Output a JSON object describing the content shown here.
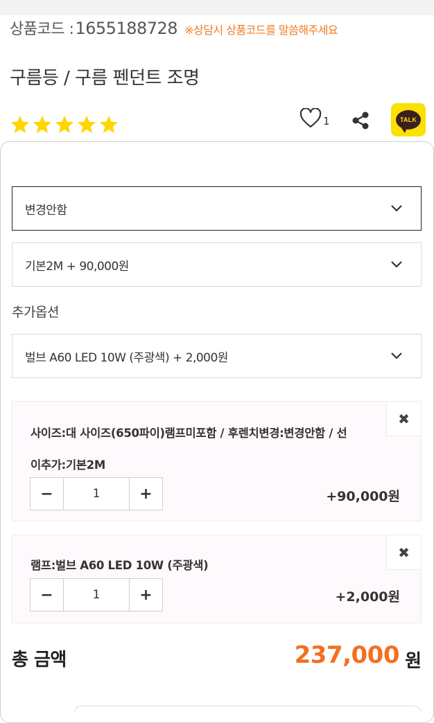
{
  "product": {
    "code_label": "상품코드 :",
    "code": "1655188728",
    "code_note": "※상담시 상품코드를 말씀해주세요",
    "title": "구름등 / 구름 펜던트 조명",
    "rating_stars": 5,
    "likes": "1",
    "star_color": "#FFD600",
    "accent_color": "#F37021",
    "kakao_label": "TALK"
  },
  "icons": {
    "like": "heart-icon",
    "share": "share-icon",
    "kakao": "kakao-talk-icon",
    "dropdown": "chevron-down-icon",
    "remove": "close-icon"
  },
  "options": {
    "select1": "변경안함",
    "select2": "기본2M  + 90,000원",
    "additional_label": "추가옵션",
    "select3": "벌브 A60 LED 10W (주광색)  + 2,000원"
  },
  "selected_items": [
    {
      "desc_line1": "사이즈:대 사이즈(650파이)램프미포함 / 후렌치변경:변경안함 / 선",
      "desc_line2": "이추가:기본2M",
      "qty": "1",
      "minus": "−",
      "plus": "+",
      "price": "+90,000원",
      "remove": "✖"
    },
    {
      "desc_line1": "램프:벌브 A60 LED 10W (주광색)",
      "qty": "1",
      "minus": "−",
      "plus": "+",
      "price": "+2,000원",
      "remove": "✖"
    }
  ],
  "total": {
    "label": "총 금액",
    "amount": "237,000",
    "unit": "원"
  }
}
